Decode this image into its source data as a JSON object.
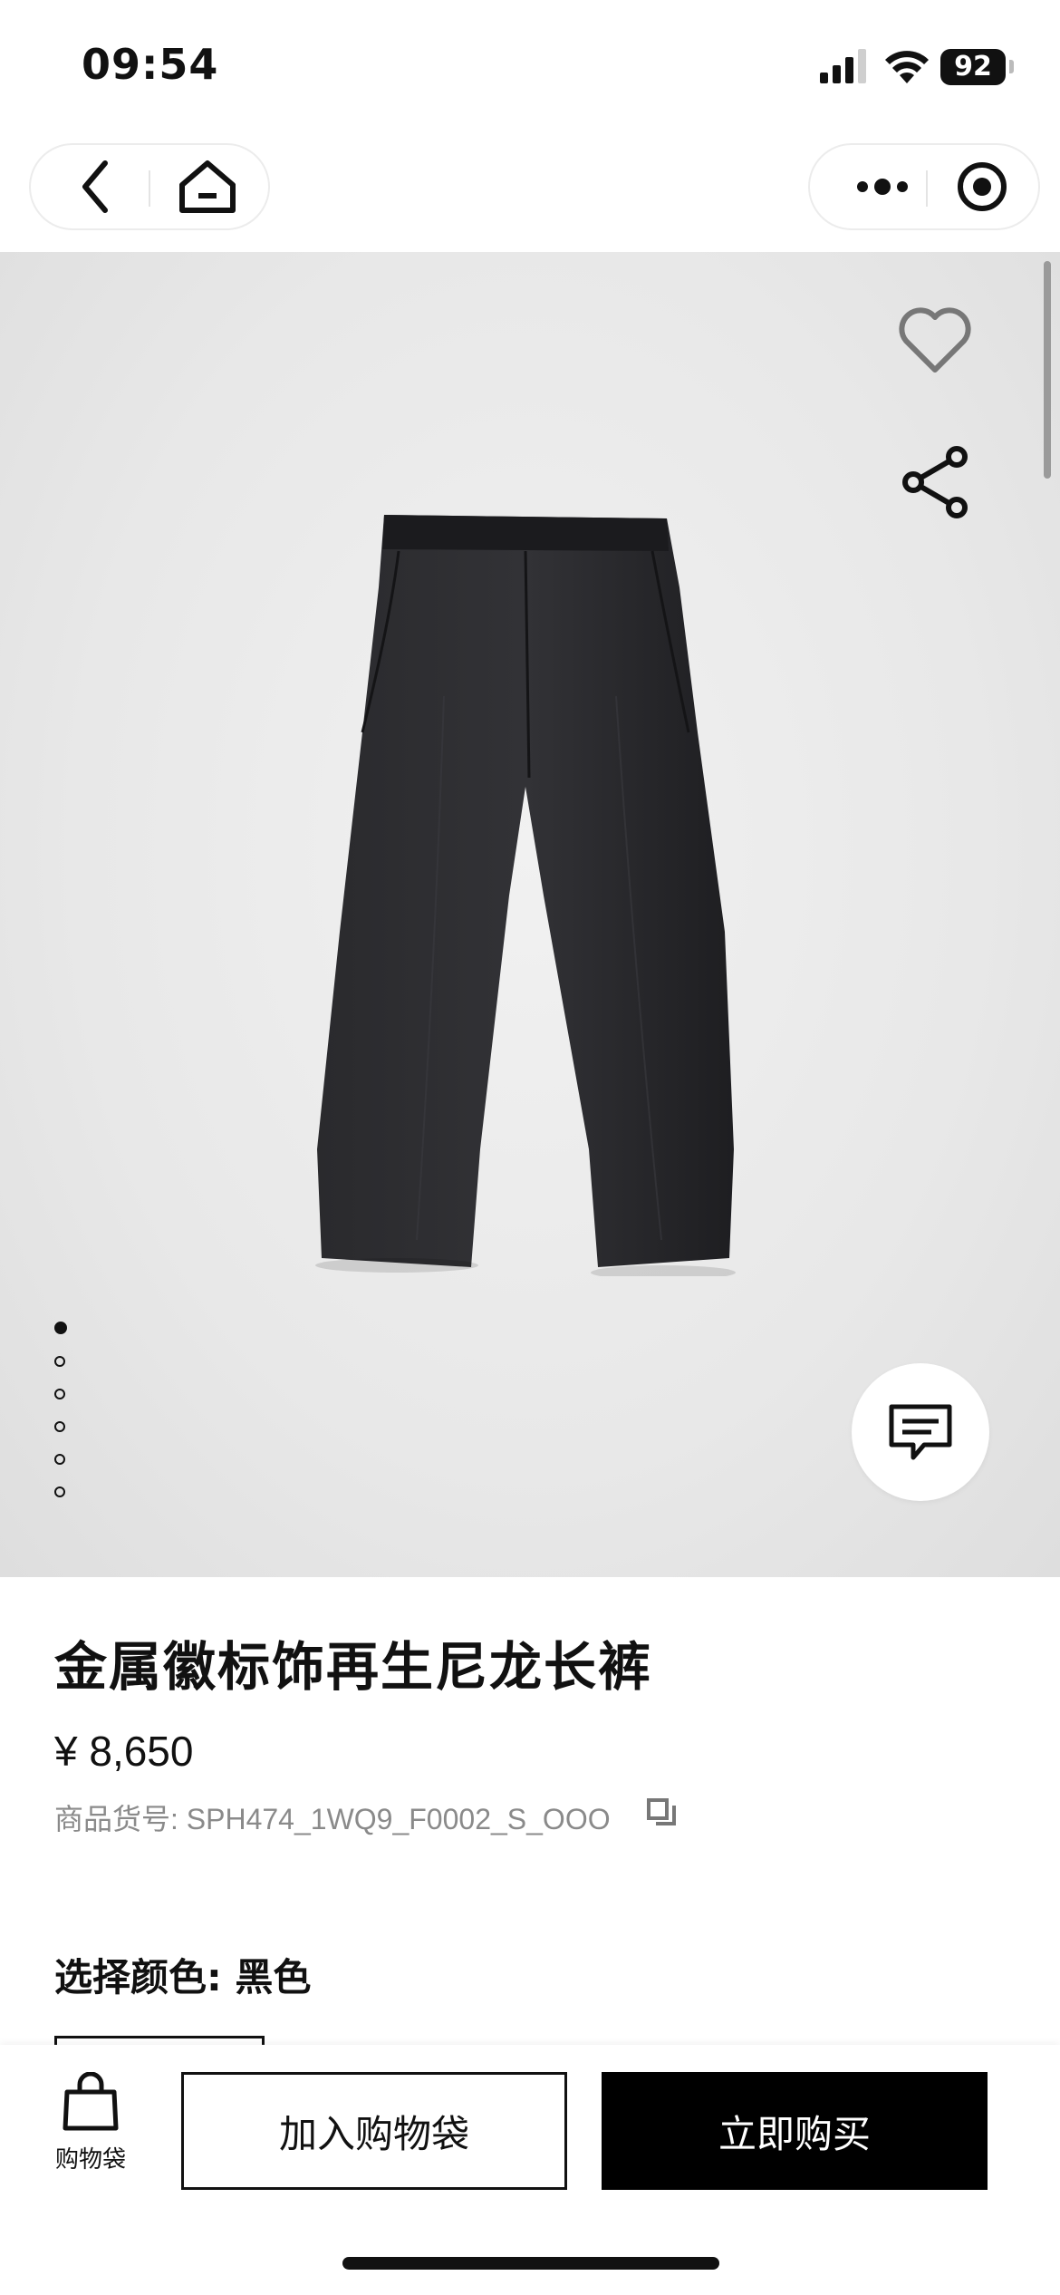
{
  "status_bar": {
    "time": "09:54",
    "battery": "92"
  },
  "nav": {
    "back_icon": "chevron-left-icon",
    "home_icon": "home-icon",
    "more_icon": "more-dots-icon",
    "target_icon": "record-target-icon"
  },
  "gallery": {
    "image_count": 6,
    "active_index": 0,
    "favorite_icon": "heart-icon",
    "share_icon": "share-icon",
    "chat_icon": "chat-icon",
    "background": "#e9e9e9"
  },
  "product": {
    "title": "金属徽标饰再生尼龙长裤",
    "price": "¥ 8,650",
    "sku": "商品货号: SPH474_1WQ9_F0002_S_OOO",
    "color_label": "选择颜色: 黑色"
  },
  "bottom_bar": {
    "bag_label": "购物袋",
    "add_to_bag": "加入购物袋",
    "buy_now": "立即购买"
  },
  "colors": {
    "accent": "#000000",
    "muted_text": "#8a8a8a"
  }
}
